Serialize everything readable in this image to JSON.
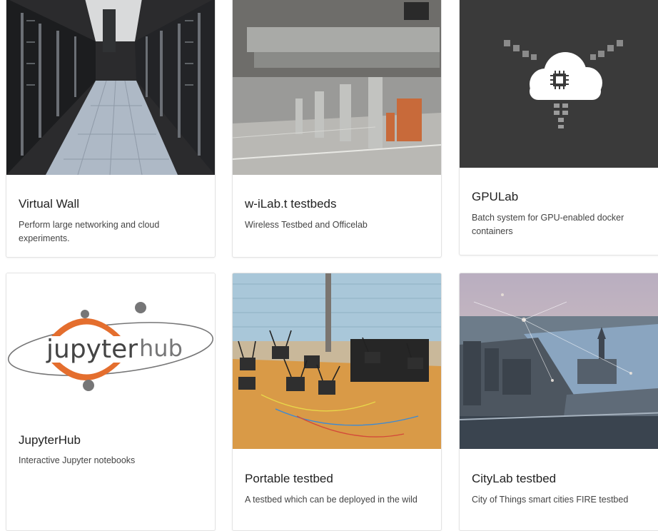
{
  "cards": [
    {
      "title": "Virtual Wall",
      "description": "Perform large networking and cloud experiments.",
      "image": "datacenter-aisle-photo"
    },
    {
      "title": "w-iLab.t testbeds",
      "description": "Wireless Testbed and Officelab",
      "image": "industrial-hall-ducts-photo"
    },
    {
      "title": "GPULab",
      "description": "Batch system for GPU-enabled docker containers",
      "image": "cloud-chip-icon"
    },
    {
      "title": "JupyterHub",
      "description": "Interactive Jupyter notebooks",
      "image": "jupyterhub-logo",
      "logo_text": {
        "left": "jupyter",
        "right": "hub"
      }
    },
    {
      "title": "Portable testbed",
      "description": "A testbed which can be deployed in the wild",
      "image": "wireless-nodes-desk-photo"
    },
    {
      "title": "CityLab testbed",
      "description": "City of Things smart cities FIRE testbed",
      "image": "city-aerial-photo"
    }
  ],
  "colors": {
    "jupyter_orange": "#e46e2e",
    "jupyter_gray": "#767677",
    "gpu_bg": "#3a3a3a"
  }
}
